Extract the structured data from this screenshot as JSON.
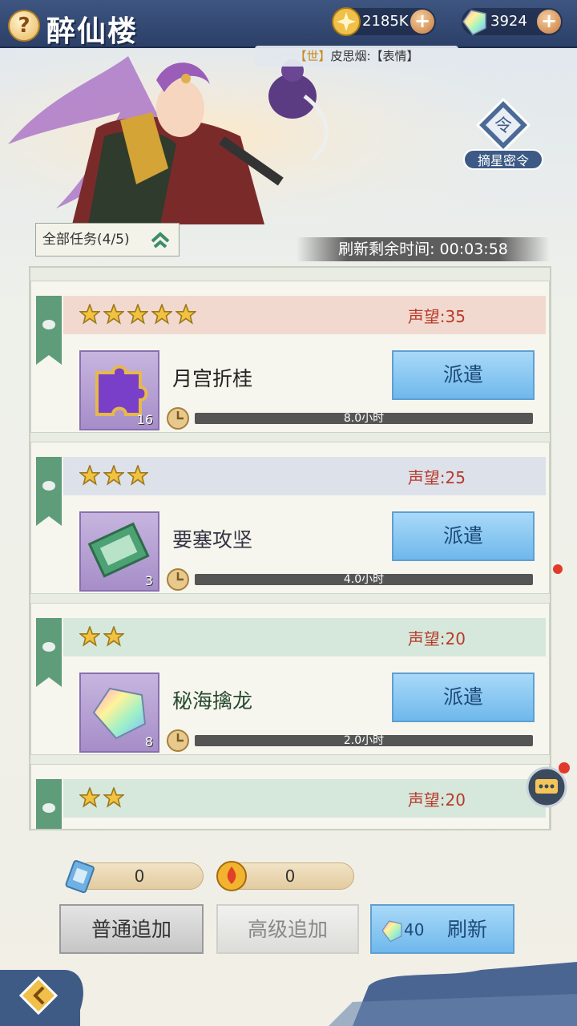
{
  "header": {
    "help_label": "?",
    "title": "醉仙楼",
    "gold_amount": "2185K",
    "gem_amount": "3924",
    "plus_label": "+"
  },
  "chat": {
    "channel": "【世】",
    "message": "皮思烟:【表情】"
  },
  "secret_order": {
    "label": "摘星密令",
    "icon_char": "令"
  },
  "filter": {
    "label": "全部任务(4/5)"
  },
  "timer": {
    "label": "刷新剩余时间:",
    "value": "00:03:58"
  },
  "tasks": [
    {
      "stars": 5,
      "reputation": "声望:35",
      "name": "月宫折桂",
      "item_count": "16",
      "item": "purple-puzzle",
      "button": "派遣",
      "duration": "8.0小时",
      "header_color": "#f2d9cf",
      "name_color": "#222222"
    },
    {
      "stars": 3,
      "reputation": "声望:25",
      "name": "要塞攻坚",
      "item_count": "3",
      "item": "green-ticket",
      "button": "派遣",
      "duration": "4.0小时",
      "header_color": "#dde1ea",
      "name_color": "#333344"
    },
    {
      "stars": 2,
      "reputation": "声望:20",
      "name": "秘海擒龙",
      "item_count": "8",
      "item": "rainbow-gem",
      "button": "派遣",
      "duration": "2.0小时",
      "header_color": "#d6e8dc",
      "name_color": "#27492f"
    },
    {
      "stars": 2,
      "reputation": "声望:20",
      "name": "",
      "item_count": "",
      "item": "",
      "button": "",
      "duration": "",
      "header_color": "#d6e8dc",
      "name_color": "#27492f"
    }
  ],
  "counters": {
    "ticket_count": "0",
    "fire_count": "0"
  },
  "buttons": {
    "normal_add": "普通追加",
    "advanced_add": "高级追加",
    "refresh_cost": "40",
    "refresh": "刷新"
  },
  "colors": {
    "accent_blue": "#6fb8ec",
    "reputation_red": "#b83a2a",
    "header_navy": "#2c4068"
  }
}
